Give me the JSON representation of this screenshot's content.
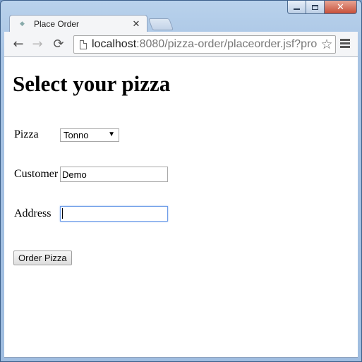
{
  "window": {
    "tab": {
      "title": "Place Order",
      "close_glyph": "✕"
    },
    "caption_buttons": {
      "close_glyph": "✕"
    }
  },
  "toolbar": {
    "back_glyph": "←",
    "forward_glyph": "→",
    "reload_glyph": "⟳",
    "url_host": "localhost",
    "url_path": ":8080/pizza-order/placeorder.jsf?pro",
    "star_glyph": "☆"
  },
  "page": {
    "heading": "Select your pizza",
    "form": {
      "pizza_label": "Pizza",
      "pizza_selected": "Tonno",
      "customer_label": "Customer",
      "customer_value": "Demo",
      "address_label": "Address",
      "address_value": "",
      "submit_label": "Order Pizza"
    }
  },
  "icons": {
    "tab_favicon": "globe-icon",
    "page_icon": "page-icon",
    "star": "star-icon",
    "menu": "hamburger-menu-icon"
  }
}
